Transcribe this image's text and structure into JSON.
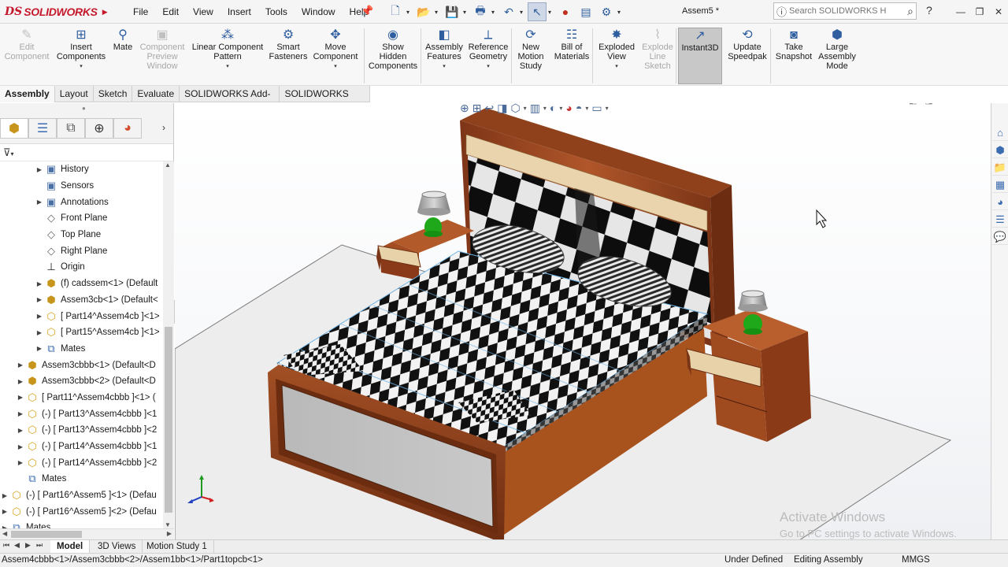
{
  "app": {
    "brand_ds": "DS",
    "brand_name": "SOLIDWORKS"
  },
  "menu": [
    "File",
    "Edit",
    "View",
    "Insert",
    "Tools",
    "Window",
    "Help"
  ],
  "document_title": "Assem5 *",
  "help_search": {
    "placeholder": "Search SOLIDWORKS Help"
  },
  "commands": [
    {
      "id": "edit-component",
      "label": "Edit\nComponent",
      "icon": "✎",
      "enabled": false,
      "dropdown": false
    },
    {
      "id": "insert-components",
      "label": "Insert\nComponents",
      "icon": "⊞",
      "enabled": true,
      "dropdown": true
    },
    {
      "id": "mate",
      "label": "Mate",
      "icon": "⚲",
      "enabled": true,
      "dropdown": false
    },
    {
      "id": "component-preview",
      "label": "Component\nPreview\nWindow",
      "icon": "▣",
      "enabled": false,
      "dropdown": false
    },
    {
      "id": "linear-pattern",
      "label": "Linear Component\nPattern",
      "icon": "⁂",
      "enabled": true,
      "dropdown": true
    },
    {
      "id": "smart-fasteners",
      "label": "Smart\nFasteners",
      "icon": "⚙",
      "enabled": true,
      "dropdown": false
    },
    {
      "id": "move-component",
      "label": "Move\nComponent",
      "icon": "✥",
      "enabled": true,
      "dropdown": true
    },
    {
      "id": "show-hidden",
      "label": "Show\nHidden\nComponents",
      "icon": "◉",
      "enabled": true,
      "dropdown": false
    },
    {
      "id": "assembly-features",
      "label": "Assembly\nFeatures",
      "icon": "◧",
      "enabled": true,
      "dropdown": true
    },
    {
      "id": "reference-geometry",
      "label": "Reference\nGeometry",
      "icon": "⟂",
      "enabled": true,
      "dropdown": true
    },
    {
      "id": "new-motion-study",
      "label": "New\nMotion\nStudy",
      "icon": "⟳",
      "enabled": true,
      "dropdown": false
    },
    {
      "id": "bill-of-materials",
      "label": "Bill of\nMaterials",
      "icon": "☷",
      "enabled": true,
      "dropdown": false
    },
    {
      "id": "exploded-view",
      "label": "Exploded\nView",
      "icon": "✸",
      "enabled": true,
      "dropdown": true
    },
    {
      "id": "explode-line-sketch",
      "label": "Explode\nLine\nSketch",
      "icon": "⌇",
      "enabled": false,
      "dropdown": false
    },
    {
      "id": "instant3d",
      "label": "Instant3D",
      "icon": "↗",
      "enabled": true,
      "dropdown": false,
      "active": true
    },
    {
      "id": "update-speedpak",
      "label": "Update\nSpeedpak",
      "icon": "⟲",
      "enabled": true,
      "dropdown": false
    },
    {
      "id": "take-snapshot",
      "label": "Take\nSnapshot",
      "icon": "◙",
      "enabled": true,
      "dropdown": false
    },
    {
      "id": "large-assembly",
      "label": "Large\nAssembly\nMode",
      "icon": "⬢",
      "enabled": true,
      "dropdown": false
    }
  ],
  "command_tabs": [
    {
      "label": "Assembly",
      "active": true
    },
    {
      "label": "Layout",
      "active": false
    },
    {
      "label": "Sketch",
      "active": false
    },
    {
      "label": "Evaluate",
      "active": false
    },
    {
      "label": "SOLIDWORKS Add-Ins",
      "active": false
    },
    {
      "label": "SOLIDWORKS MBD",
      "active": false
    }
  ],
  "tree": [
    {
      "label": "History",
      "icon": "folder",
      "expand": true,
      "indent": 1
    },
    {
      "label": "Sensors",
      "icon": "folder",
      "expand": false,
      "indent": 1
    },
    {
      "label": "Annotations",
      "icon": "folder",
      "expand": true,
      "indent": 1
    },
    {
      "label": "Front Plane",
      "icon": "plane",
      "expand": false,
      "indent": 1
    },
    {
      "label": "Top Plane",
      "icon": "plane",
      "expand": false,
      "indent": 1
    },
    {
      "label": "Right Plane",
      "icon": "plane",
      "expand": false,
      "indent": 1
    },
    {
      "label": "Origin",
      "icon": "origin",
      "expand": false,
      "indent": 1
    },
    {
      "label": "(f) cadssem<1> (Default",
      "icon": "asm",
      "expand": true,
      "indent": 1
    },
    {
      "label": "Assem3cb<1> (Default<",
      "icon": "asm",
      "expand": true,
      "indent": 1
    },
    {
      "label": "[ Part14^Assem4cb ]<1>",
      "icon": "part",
      "expand": true,
      "indent": 1
    },
    {
      "label": "[ Part15^Assem4cb ]<1>",
      "icon": "part",
      "expand": true,
      "indent": 1
    },
    {
      "label": "Mates",
      "icon": "mates",
      "expand": true,
      "indent": 1
    },
    {
      "label": "Assem3cbbb<1> (Default<D",
      "icon": "asm",
      "expand": true,
      "indent": 0
    },
    {
      "label": "Assem3cbbb<2> (Default<D",
      "icon": "asm",
      "expand": true,
      "indent": 0
    },
    {
      "label": "[ Part11^Assem4cbbb ]<1> (",
      "icon": "part",
      "expand": true,
      "indent": 0
    },
    {
      "label": "(-) [ Part13^Assem4cbbb ]<1",
      "icon": "part",
      "expand": true,
      "indent": 0
    },
    {
      "label": "(-) [ Part13^Assem4cbbb ]<2",
      "icon": "part",
      "expand": true,
      "indent": 0
    },
    {
      "label": "(-) [ Part14^Assem4cbbb ]<1",
      "icon": "part",
      "expand": true,
      "indent": 0
    },
    {
      "label": "(-) [ Part14^Assem4cbbb ]<2",
      "icon": "part",
      "expand": true,
      "indent": 0
    },
    {
      "label": "Mates",
      "icon": "mates",
      "expand": false,
      "indent": 0
    },
    {
      "label": "(-) [ Part16^Assem5 ]<1> (Defau",
      "icon": "part",
      "expand": true,
      "indent": -1
    },
    {
      "label": "(-) [ Part16^Assem5 ]<2> (Defau",
      "icon": "part",
      "expand": true,
      "indent": -1
    },
    {
      "label": "Mates",
      "icon": "mates",
      "expand": true,
      "indent": -1
    }
  ],
  "bottom_tabs": [
    {
      "label": "Model",
      "active": true
    },
    {
      "label": "3D Views",
      "active": false
    },
    {
      "label": "Motion Study 1",
      "active": false
    }
  ],
  "status": {
    "path": "Assem4cbbb<1>/Assem3cbbb<2>/Assem1bb<1>/Part1topcb<1>",
    "definition": "Under Defined",
    "mode": "Editing Assembly",
    "units": "MMGS"
  },
  "watermark": {
    "title": "Activate Windows",
    "subtitle": "Go to PC settings to activate Windows."
  },
  "colors": {
    "brand": "#c5182b",
    "wood": "#9c4a1f",
    "wood_light": "#e8d4ae",
    "lamp_base": "#22a91c",
    "floor": "#ececec"
  }
}
